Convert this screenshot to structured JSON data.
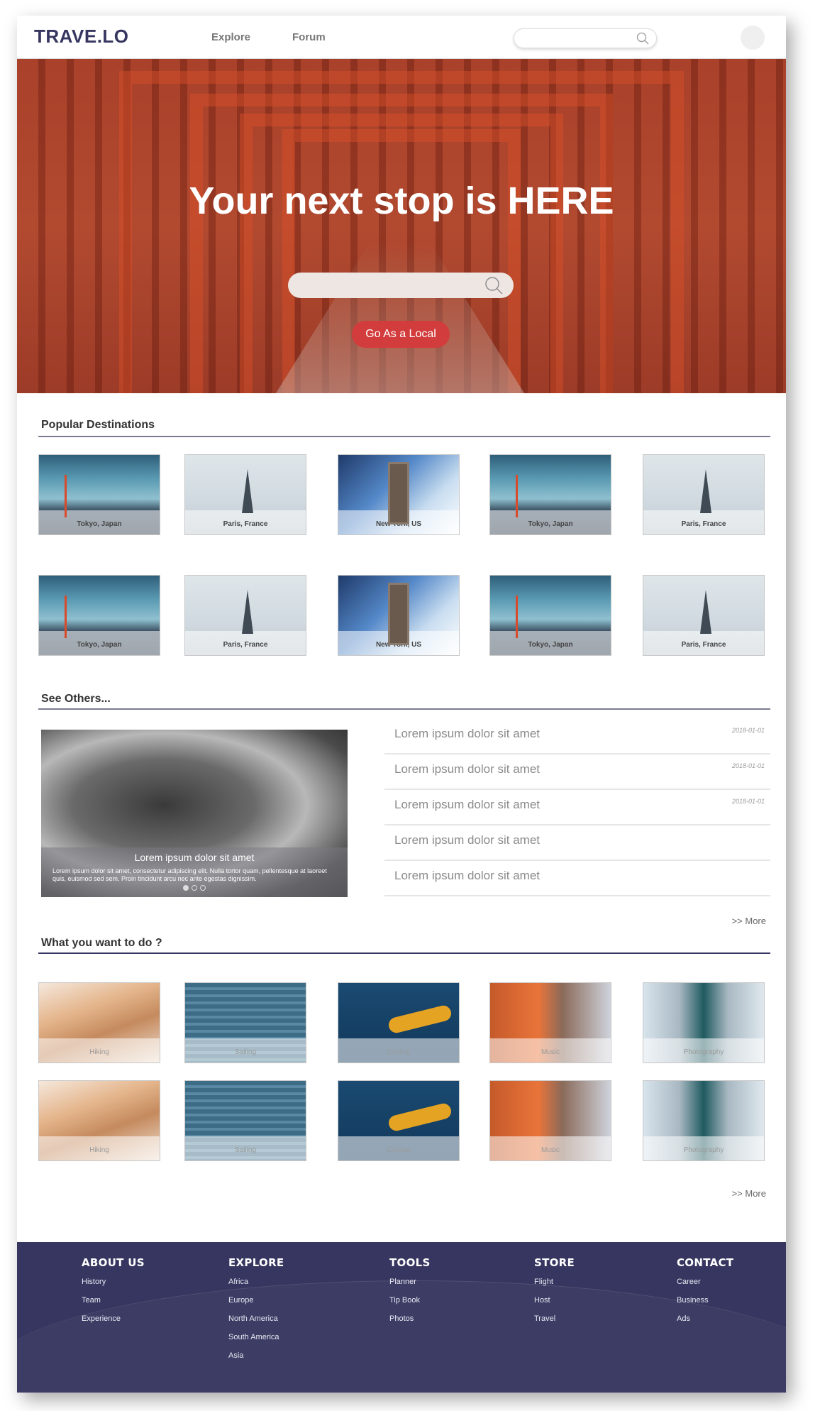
{
  "header": {
    "logo": "TRAVE.LO",
    "nav": [
      "Explore",
      "Forum"
    ],
    "search_placeholder": ""
  },
  "hero": {
    "title": "Your next stop is HERE",
    "search_placeholder": "",
    "cta_label": "Go As a Local"
  },
  "destinations": {
    "title": "Popular Destinations",
    "cards": [
      {
        "label": "Tokyo, Japan"
      },
      {
        "label": "Paris, France"
      },
      {
        "label": "New York, US"
      },
      {
        "label": "Tokyo, Japan"
      },
      {
        "label": "Paris, France"
      },
      {
        "label": "Tokyo, Japan"
      },
      {
        "label": "Paris, France"
      },
      {
        "label": "New York, US"
      },
      {
        "label": "Tokyo, Japan"
      },
      {
        "label": "Paris, France"
      }
    ]
  },
  "others": {
    "title": "See Others...",
    "feature_title": "Lorem ipsum dolor sit amet",
    "feature_desc": "Lorem ipsum dolor sit amet, consectetur adipiscing elit. Nulla tortor quam, pellentesque at laoreet quis, euismod sed sem. Proin tincidunt arcu nec ante egestas dignissim.",
    "news": [
      {
        "title": "Lorem ipsum dolor sit amet",
        "date": "2018-01-01"
      },
      {
        "title": "Lorem ipsum dolor sit amet",
        "date": "2018-01-01"
      },
      {
        "title": "Lorem ipsum dolor sit amet",
        "date": "2018-01-01"
      },
      {
        "title": "Lorem ipsum dolor sit amet",
        "date": ""
      },
      {
        "title": "Lorem ipsum dolor sit amet",
        "date": ""
      }
    ],
    "more": ">> More"
  },
  "activities": {
    "title": "What you want to do ?",
    "cards": [
      {
        "label": "Hiking"
      },
      {
        "label": "Sailing"
      },
      {
        "label": "Cycling"
      },
      {
        "label": "Music"
      },
      {
        "label": "Photography"
      },
      {
        "label": "Hiking"
      },
      {
        "label": "Sailing"
      },
      {
        "label": "Cycling"
      },
      {
        "label": "Music"
      },
      {
        "label": "Photography"
      }
    ],
    "more": ">> More"
  },
  "footer": {
    "columns": [
      {
        "heading": "ABOUT US",
        "items": [
          "History",
          "Team",
          "Experience"
        ]
      },
      {
        "heading": "EXPLORE",
        "items": [
          "Africa",
          "Europe",
          "North America",
          "South America",
          "Asia"
        ]
      },
      {
        "heading": "TOOLS",
        "items": [
          "Planner",
          "Tip Book",
          "Photos"
        ]
      },
      {
        "heading": "STORE",
        "items": [
          "Flight",
          "Host",
          "Travel"
        ]
      },
      {
        "heading": "CONTACT",
        "items": [
          "Career",
          "Business",
          "Ads"
        ]
      }
    ]
  },
  "colors": {
    "brand": "#363660",
    "cta": "#d33c3c",
    "hero_tint": "#a9412b"
  },
  "icons": {
    "header_search": "search-icon",
    "hero_search": "search-icon"
  }
}
